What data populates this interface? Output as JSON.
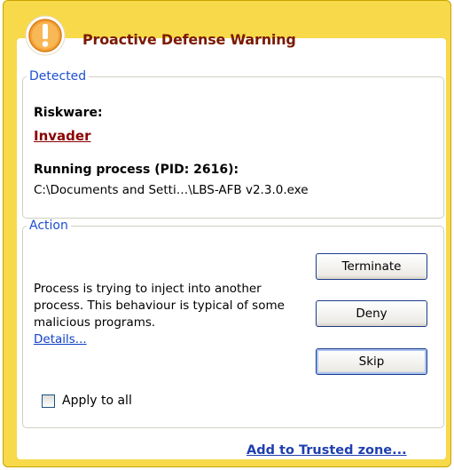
{
  "window": {
    "title": "Proactive Defense Warning",
    "accent_color": "#f7d94a",
    "title_color": "#7a1a00"
  },
  "detected": {
    "legend": "Detected",
    "type_label": "Riskware:",
    "threat_name": "Invader",
    "process_label": "Running process (PID: 2616):",
    "process_path": "C:\\Documents and Setti…\\LBS-AFB v2.3.0.exe"
  },
  "action": {
    "legend": "Action",
    "description": "Process is trying to inject into another process. This behaviour is typical of some malicious programs.",
    "details_link": "Details...",
    "buttons": {
      "terminate": "Terminate",
      "deny": "Deny",
      "skip": "Skip"
    },
    "apply_all_label": "Apply to all",
    "apply_all_checked": false
  },
  "footer": {
    "trusted_link": "Add to Trusted zone..."
  },
  "icons": {
    "warning": "warning-exclamation-icon"
  }
}
